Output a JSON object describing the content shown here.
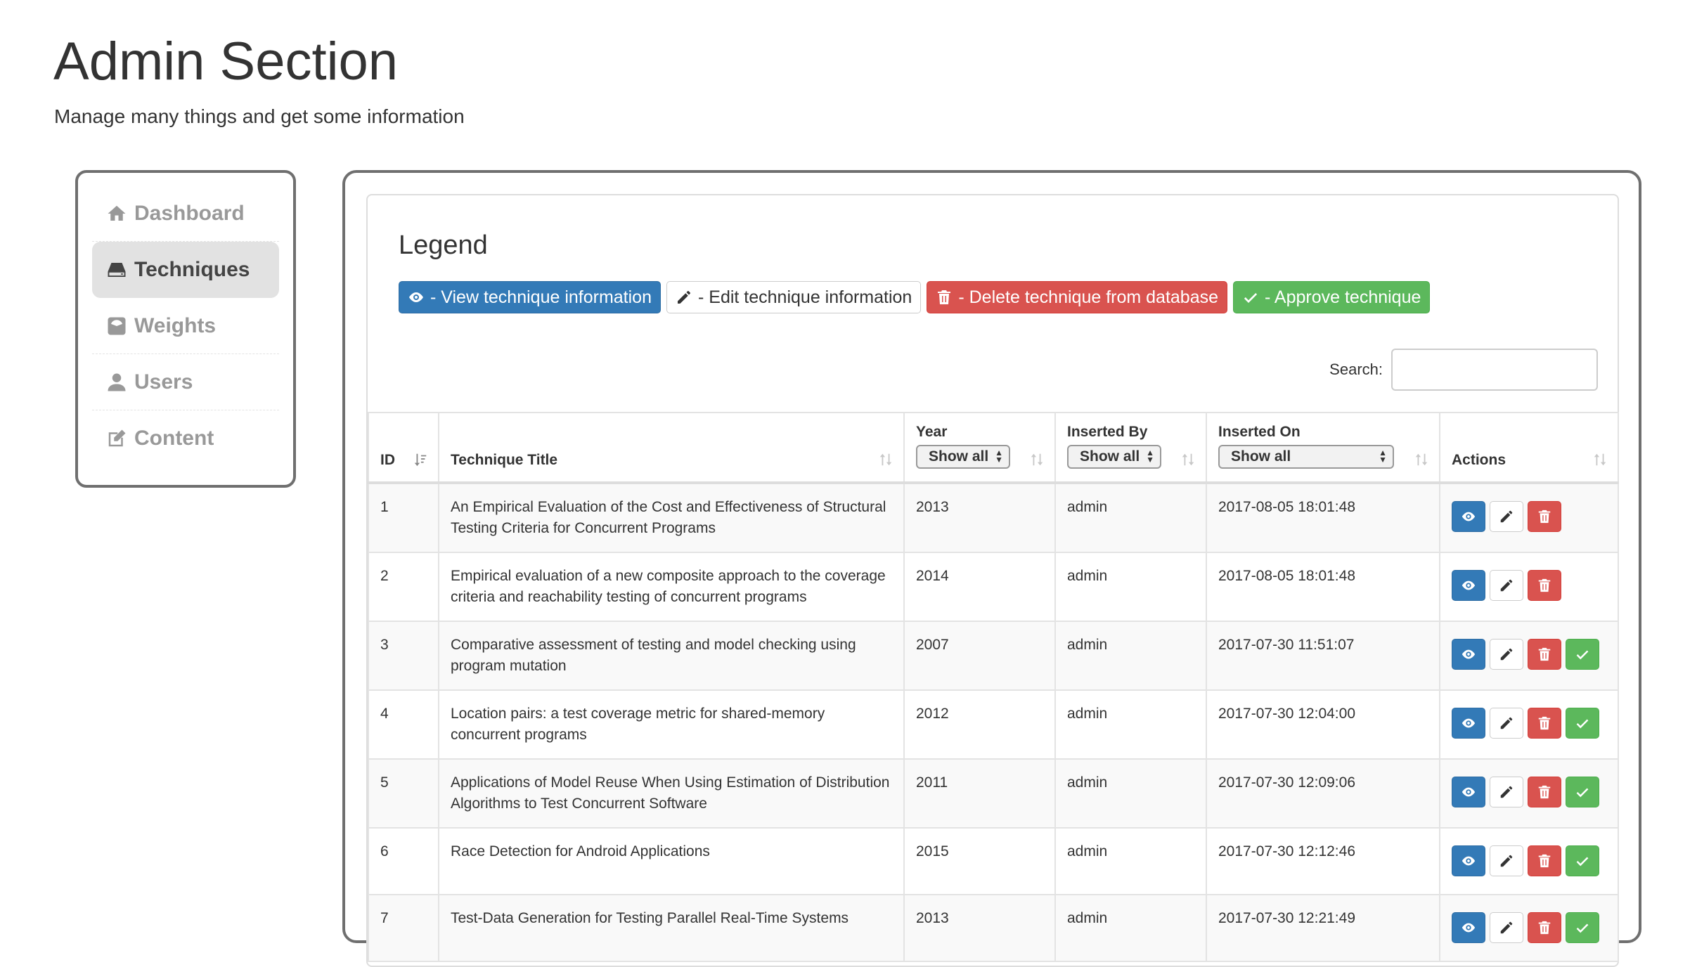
{
  "header": {
    "title": "Admin Section",
    "subtitle": "Manage many things and get some information"
  },
  "sidebar": {
    "items": [
      {
        "label": "Dashboard",
        "icon": "home-icon",
        "active": false
      },
      {
        "label": "Techniques",
        "icon": "hdd-icon",
        "active": true
      },
      {
        "label": "Weights",
        "icon": "scale-icon",
        "active": false
      },
      {
        "label": "Users",
        "icon": "user-icon",
        "active": false
      },
      {
        "label": "Content",
        "icon": "edit-icon",
        "active": false
      }
    ]
  },
  "legend": {
    "title": "Legend",
    "view": "- View technique information",
    "edit": "- Edit technique information",
    "delete": "- Delete technique from database",
    "approve": "- Approve technique"
  },
  "search": {
    "label": "Search:",
    "value": ""
  },
  "table": {
    "columns": {
      "id": "ID",
      "title": "Technique Title",
      "year": "Year",
      "inserted_by": "Inserted By",
      "inserted_on": "Inserted On",
      "actions": "Actions"
    },
    "filters": {
      "year": "Show all",
      "inserted_by": "Show all",
      "inserted_on": "Show all"
    },
    "rows": [
      {
        "id": "1",
        "title": "An Empirical Evaluation of the Cost and Effectiveness of Structural Testing Criteria for Concurrent Programs",
        "year": "2013",
        "inserted_by": "admin",
        "inserted_on": "2017-08-05 18:01:48",
        "approve": false
      },
      {
        "id": "2",
        "title": "Empirical evaluation of a new composite approach to the coverage criteria and reachability testing of concurrent programs",
        "year": "2014",
        "inserted_by": "admin",
        "inserted_on": "2017-08-05 18:01:48",
        "approve": false
      },
      {
        "id": "3",
        "title": "Comparative assessment of testing and model checking using program mutation",
        "year": "2007",
        "inserted_by": "admin",
        "inserted_on": "2017-07-30 11:51:07",
        "approve": true
      },
      {
        "id": "4",
        "title": "Location pairs: a test coverage metric for shared-memory concurrent programs",
        "year": "2012",
        "inserted_by": "admin",
        "inserted_on": "2017-07-30 12:04:00",
        "approve": true
      },
      {
        "id": "5",
        "title": "Applications of Model Reuse When Using Estimation of Distribution Algorithms to Test Concurrent Software",
        "year": "2011",
        "inserted_by": "admin",
        "inserted_on": "2017-07-30 12:09:06",
        "approve": true
      },
      {
        "id": "6",
        "title": "Race Detection for Android Applications",
        "year": "2015",
        "inserted_by": "admin",
        "inserted_on": "2017-07-30 12:12:46",
        "approve": true
      },
      {
        "id": "7",
        "title": "Test-Data Generation for Testing Parallel Real-Time Systems",
        "year": "2013",
        "inserted_by": "admin",
        "inserted_on": "2017-07-30 12:21:49",
        "approve": true
      }
    ]
  },
  "colors": {
    "primary": "#337ab7",
    "danger": "#d9534f",
    "success": "#5cb85c",
    "border": "#6f6f6f"
  }
}
